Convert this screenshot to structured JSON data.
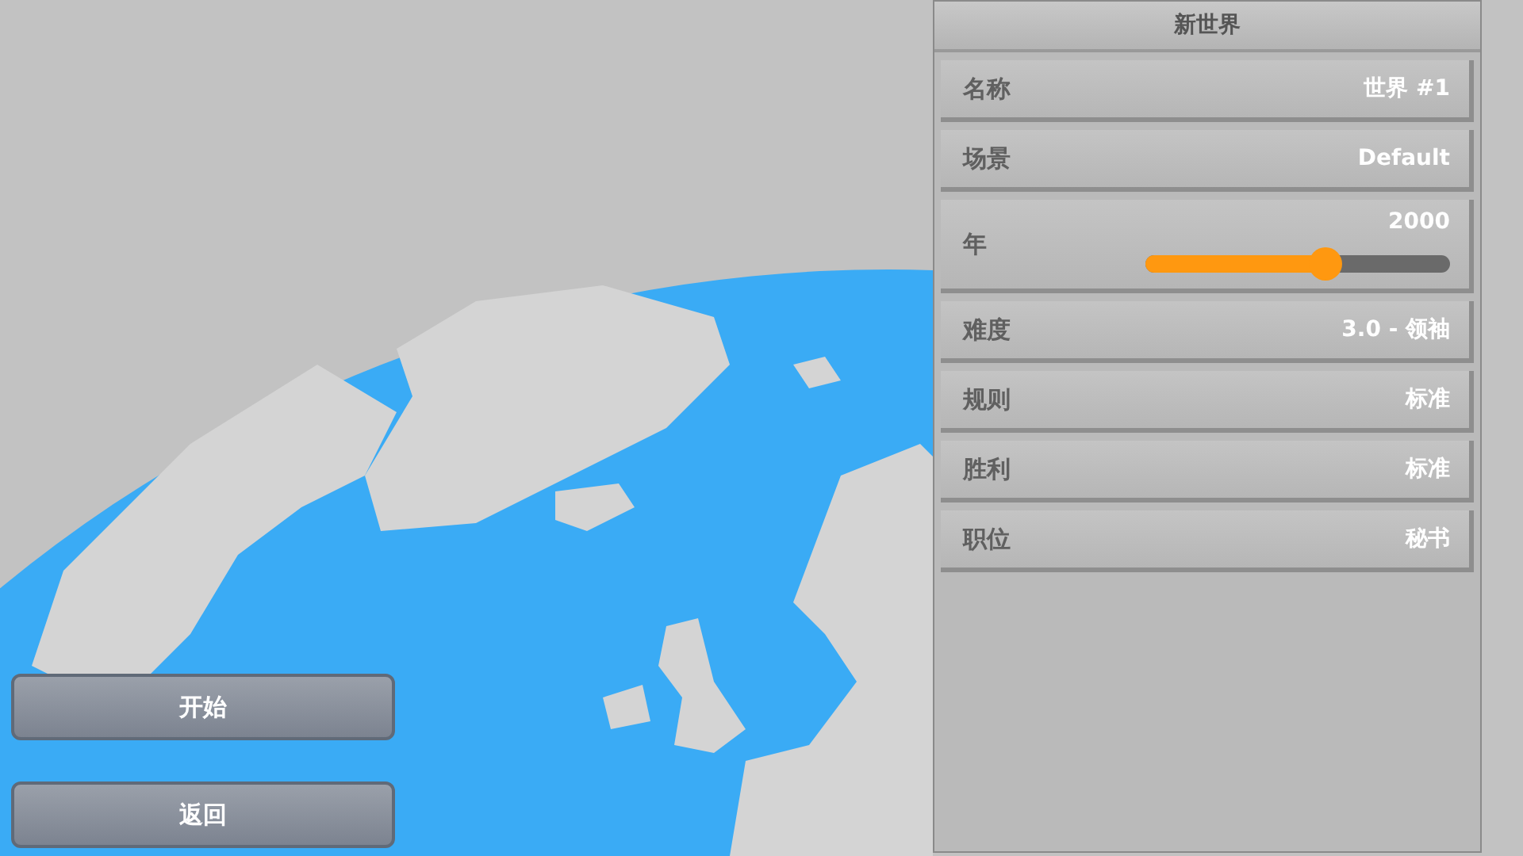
{
  "panel": {
    "title": "新世界",
    "rows": [
      {
        "kind": "value",
        "label": "名称",
        "value": "世界 #1"
      },
      {
        "kind": "value",
        "label": "场景",
        "value": "Default"
      },
      {
        "kind": "slider",
        "label": "年",
        "value": "2000",
        "level": 0.59
      },
      {
        "kind": "value",
        "label": "难度",
        "value": "3.0 - 领袖"
      },
      {
        "kind": "value",
        "label": "规则",
        "value": "标准"
      },
      {
        "kind": "value",
        "label": "胜利",
        "value": "标准"
      },
      {
        "kind": "value",
        "label": "职位",
        "value": "秘书"
      }
    ]
  },
  "buttons": [
    "开始",
    "返回"
  ]
}
